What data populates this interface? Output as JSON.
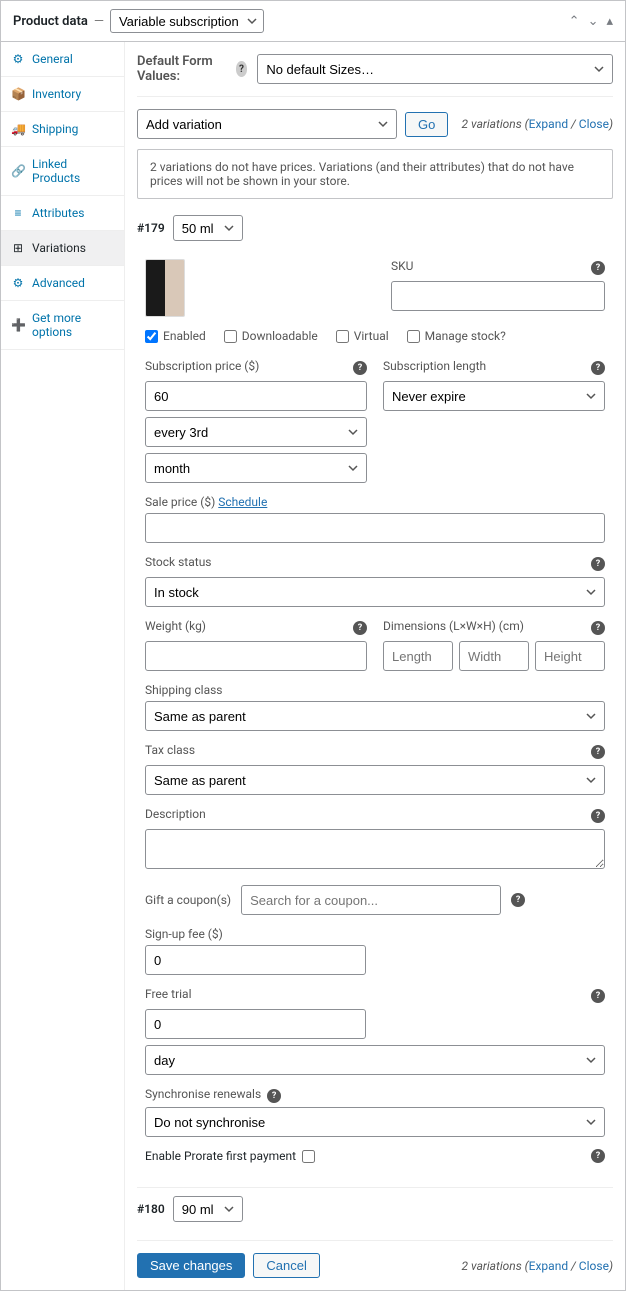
{
  "header": {
    "title": "Product data",
    "sep": "—",
    "product_type": "Variable subscription"
  },
  "sidebar": {
    "items": [
      {
        "icon": "⚙",
        "label": "General"
      },
      {
        "icon": "📦",
        "label": "Inventory"
      },
      {
        "icon": "🚚",
        "label": "Shipping"
      },
      {
        "icon": "🔗",
        "label": "Linked Products"
      },
      {
        "icon": "≡",
        "label": "Attributes"
      },
      {
        "icon": "⊞",
        "label": "Variations"
      },
      {
        "icon": "⚙",
        "label": "Advanced"
      },
      {
        "icon": "➕",
        "label": "Get more options"
      }
    ]
  },
  "top": {
    "default_label": "Default Form Values:",
    "default_value": "No default Sizes…",
    "add_variation": "Add variation",
    "go_button": "Go",
    "variations_count": "2 variations",
    "expand": "Expand",
    "close": "Close",
    "sep": " / ",
    "paren_open": "(",
    "paren_close": ")"
  },
  "notice": "2 variations do not have prices. Variations and their attributes that do not have prices will not be shown in your store.",
  "notice_full": "2 variations do not have prices. Variations (and their attributes) that do not have prices will not be shown in your store.",
  "v179": {
    "id": "#179",
    "size": "50 ml",
    "sku_label": "SKU",
    "sku": "",
    "cb_enabled": "Enabled",
    "cb_downloadable": "Downloadable",
    "cb_virtual": "Virtual",
    "cb_manage_stock": "Manage stock?",
    "sub_price_label": "Subscription price ($)",
    "sub_price": "60",
    "interval": "every 3rd",
    "period": "month",
    "sub_length_label": "Subscription length",
    "sub_length": "Never expire",
    "sale_label": "Sale price ($) ",
    "sale_schedule": "Schedule",
    "sale_value": "",
    "stock_label": "Stock status",
    "stock_value": "In stock",
    "weight_label": "Weight (kg)",
    "weight_value": "",
    "dims_label": "Dimensions (L×W×H) (cm)",
    "dims_length": "Length",
    "dims_width": "Width",
    "dims_height": "Height",
    "shipping_label": "Shipping class",
    "shipping_value": "Same as parent",
    "tax_label": "Tax class",
    "tax_value": "Same as parent",
    "desc_label": "Description",
    "desc_value": "",
    "gift_label": "Gift a coupon(s)",
    "gift_placeholder": "Search for a coupon...",
    "signup_label": "Sign-up fee ($)",
    "signup_value": "0",
    "trial_label": "Free trial",
    "trial_value": "0",
    "trial_period": "day",
    "sync_label": "Synchronise renewals",
    "sync_value": "Do not synchronise",
    "prorate_label": "Enable Prorate first payment"
  },
  "v180": {
    "id": "#180",
    "size": "90 ml"
  },
  "footer": {
    "save": "Save changes",
    "cancel": "Cancel",
    "variations_count": "2 variations",
    "expand": "Expand",
    "close": "Close"
  }
}
